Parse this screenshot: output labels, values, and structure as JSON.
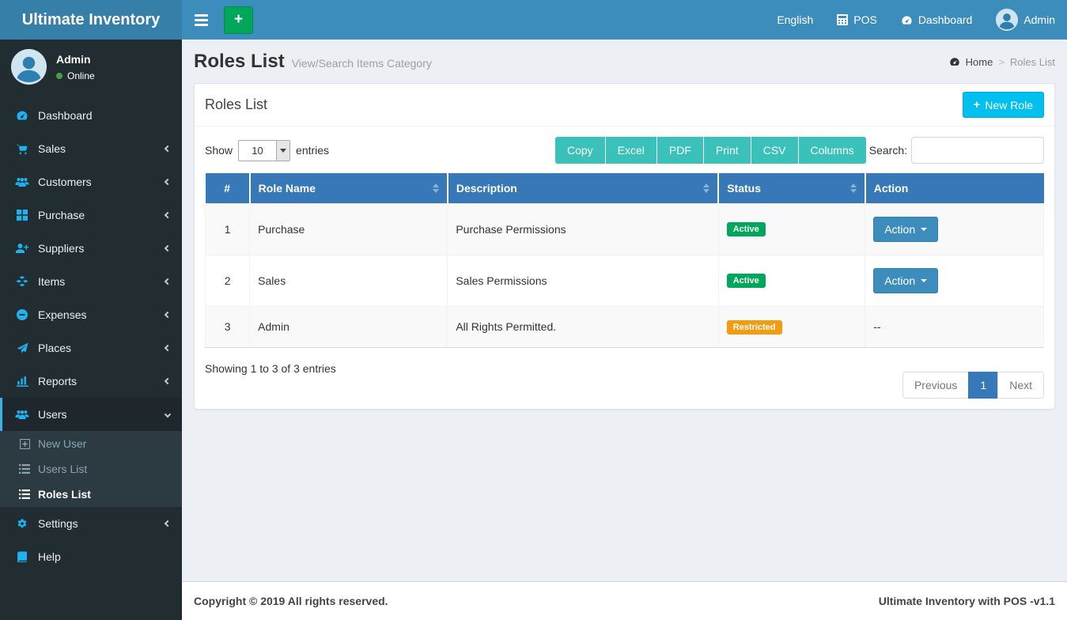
{
  "app": {
    "name": "Ultimate Inventory"
  },
  "navbar": {
    "language": "English",
    "pos": "POS",
    "dashboard": "Dashboard",
    "user": "Admin"
  },
  "sidebar": {
    "user": {
      "name": "Admin",
      "status": "Online"
    },
    "items": [
      {
        "label": "Dashboard",
        "icon": "dashboard-icon"
      },
      {
        "label": "Sales",
        "icon": "cart-icon"
      },
      {
        "label": "Customers",
        "icon": "users-icon"
      },
      {
        "label": "Purchase",
        "icon": "grid-icon"
      },
      {
        "label": "Suppliers",
        "icon": "user-plus-icon"
      },
      {
        "label": "Items",
        "icon": "cubes-icon"
      },
      {
        "label": "Expenses",
        "icon": "minus-circle-icon"
      },
      {
        "label": "Places",
        "icon": "paper-plane-icon"
      },
      {
        "label": "Reports",
        "icon": "bar-chart-icon"
      },
      {
        "label": "Users",
        "icon": "users-icon"
      },
      {
        "label": "Settings",
        "icon": "gears-icon"
      },
      {
        "label": "Help",
        "icon": "book-icon"
      }
    ],
    "submenu": [
      {
        "label": "New User",
        "icon": "plus-square-icon"
      },
      {
        "label": "Users List",
        "icon": "list-icon"
      },
      {
        "label": "Roles List",
        "icon": "list-icon"
      }
    ]
  },
  "page": {
    "title": "Roles List",
    "subtitle": "View/Search Items Category"
  },
  "breadcrumb": {
    "home": "Home",
    "separator": ">",
    "current": "Roles List"
  },
  "card": {
    "title": "Roles List",
    "new_role_label": "New Role"
  },
  "controls": {
    "show_label": "Show",
    "page_size": "10",
    "entries_label": "entries",
    "export_buttons": [
      "Copy",
      "Excel",
      "PDF",
      "Print",
      "CSV",
      "Columns"
    ],
    "search_label": "Search:",
    "search_value": ""
  },
  "table": {
    "columns": [
      "#",
      "Role Name",
      "Description",
      "Status",
      "Action"
    ],
    "rows": [
      {
        "num": "1",
        "name": "Purchase",
        "description": "Purchase Permissions",
        "status": "Active",
        "action": "Action"
      },
      {
        "num": "2",
        "name": "Sales",
        "description": "Sales Permissions",
        "status": "Active",
        "action": "Action"
      },
      {
        "num": "3",
        "name": "Admin",
        "description": "All Rights Permitted.",
        "status": "Restricted",
        "action": "--"
      }
    ]
  },
  "info": "Showing 1 to 3 of 3 entries",
  "pagination": {
    "previous": "Previous",
    "current": "1",
    "next": "Next"
  },
  "footer": {
    "left": "Copyright © 2019 All rights reserved.",
    "right": "Ultimate Inventory with POS -v1.1"
  },
  "colors": {
    "navbar": "#3c8dbc",
    "logo_bg": "#367fa9",
    "sidebar_bg": "#222d32",
    "sidebar_submenu_bg": "#2c3b41",
    "sidebar_icon": "#1eb2f0",
    "table_header": "#3779b8",
    "badge_active": "#00a65a",
    "badge_restricted": "#f39c12",
    "new_role_button": "#00c0ef",
    "export_button": "#3ac1ba",
    "action_button": "#3c8dbc",
    "green_plus_button": "#00a65a"
  }
}
